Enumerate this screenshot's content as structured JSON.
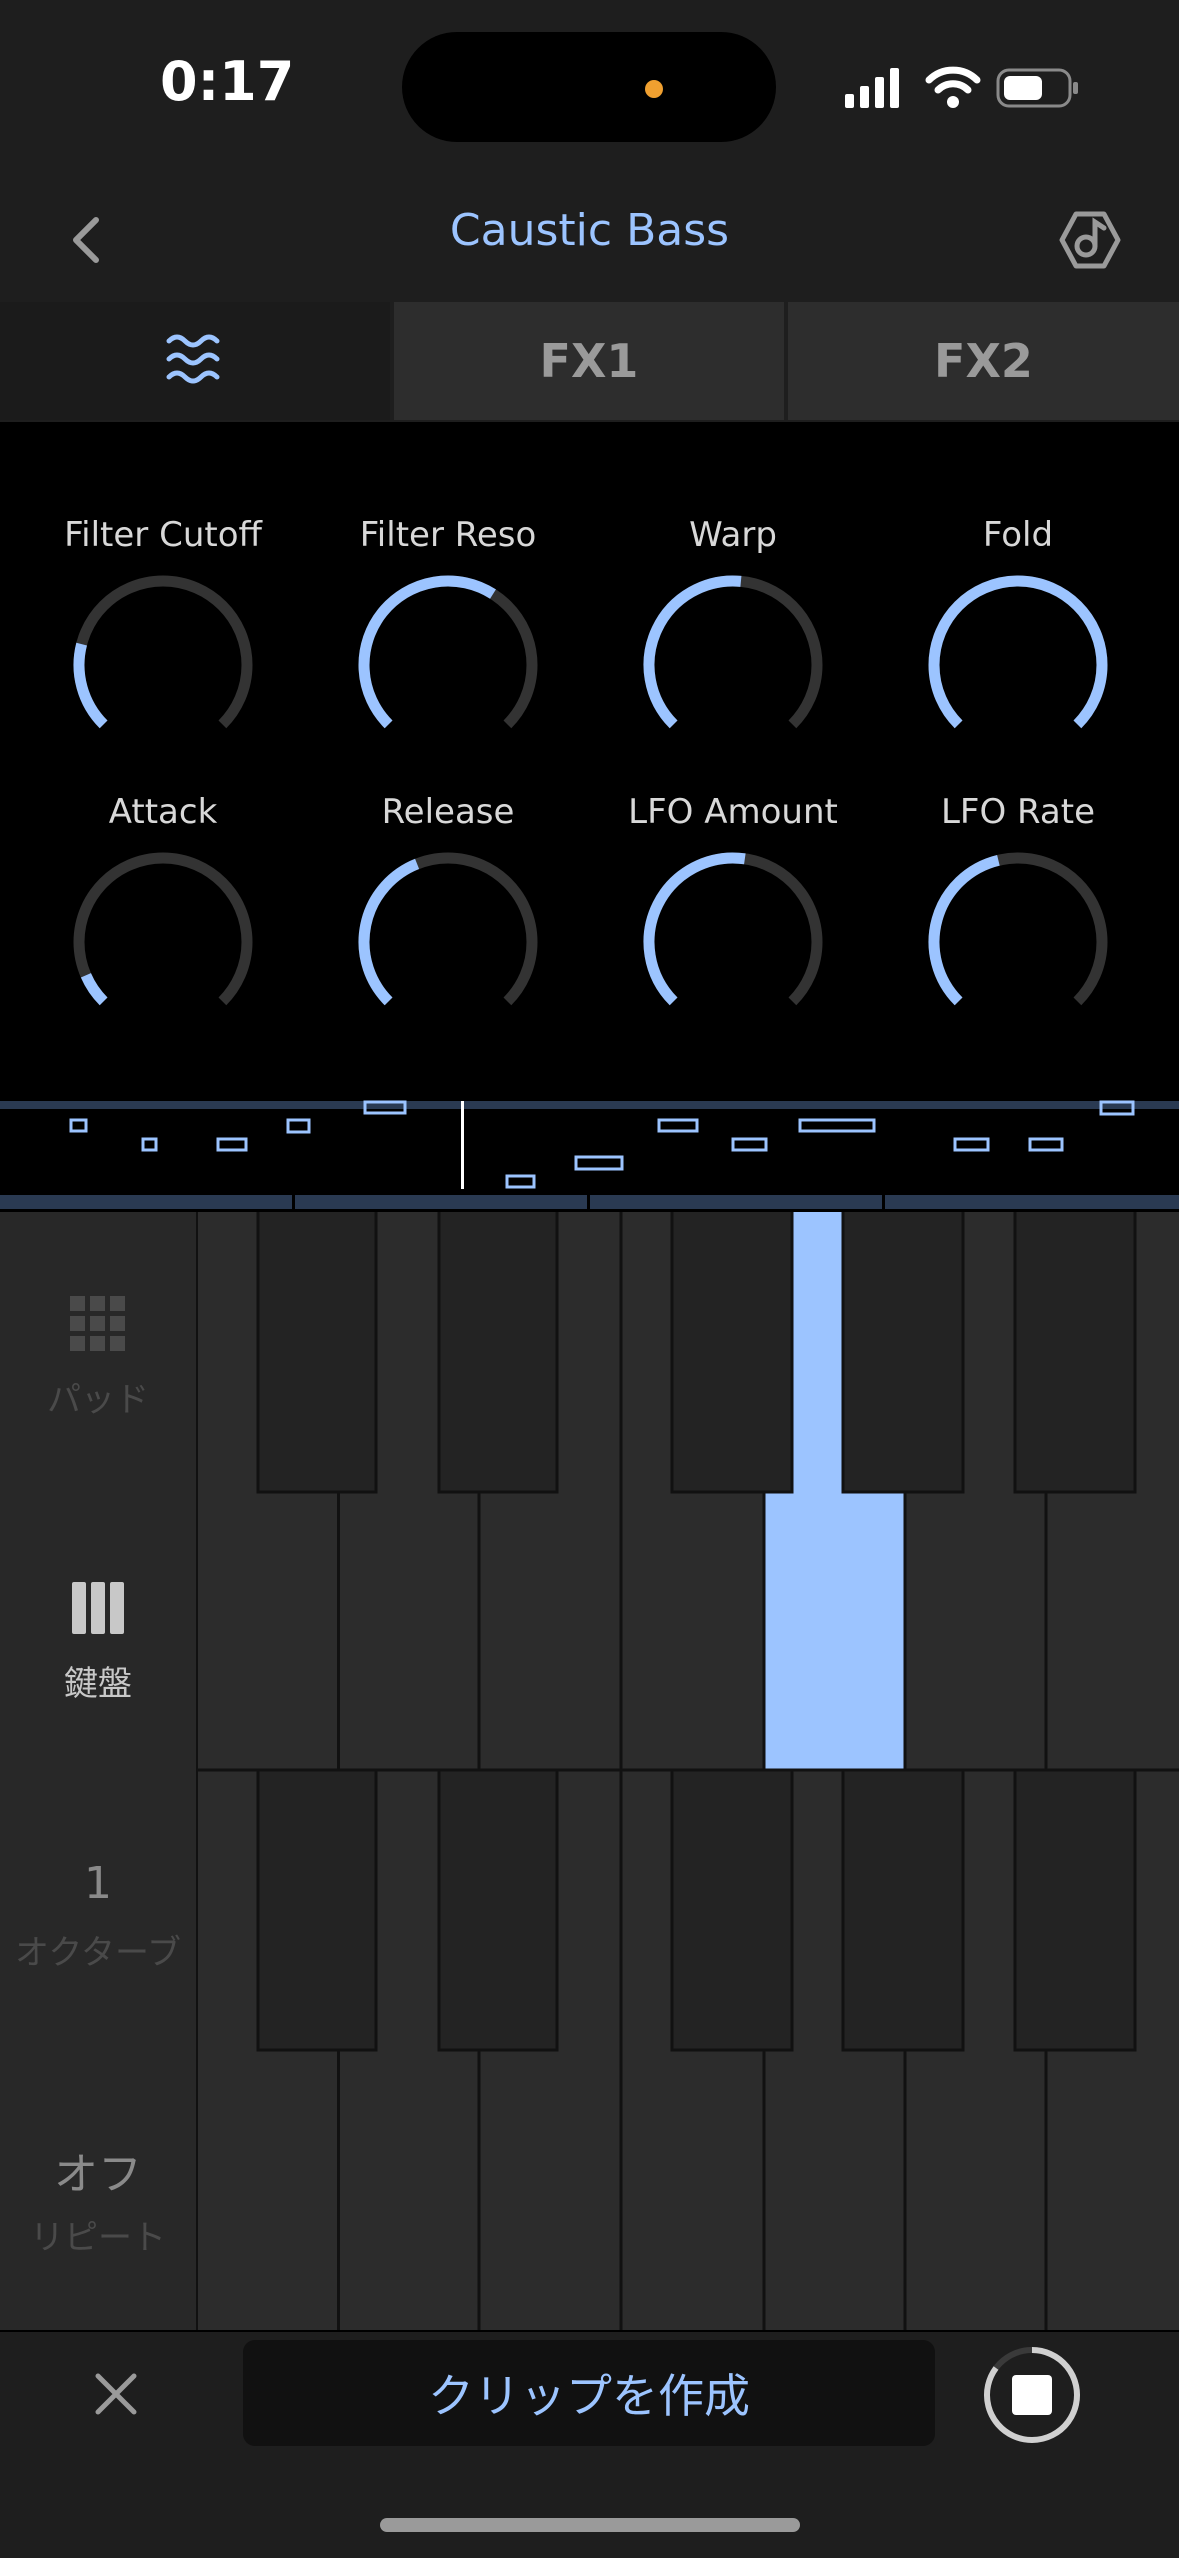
{
  "status_bar": {
    "time": "0:17"
  },
  "header": {
    "title": "Caustic Bass"
  },
  "tabs": [
    {
      "id": "waveform",
      "label": ""
    },
    {
      "id": "fx1",
      "label": "FX1"
    },
    {
      "id": "fx2",
      "label": "FX2"
    }
  ],
  "knobs": [
    {
      "label": "Filter Cutoff",
      "value": 0.22
    },
    {
      "label": "Filter Reso",
      "value": 0.62
    },
    {
      "label": "Warp",
      "value": 0.52
    },
    {
      "label": "Fold",
      "value": 1.0
    },
    {
      "label": "Attack",
      "value": 0.08
    },
    {
      "label": "Release",
      "value": 0.42
    },
    {
      "label": "LFO Amount",
      "value": 0.53
    },
    {
      "label": "LFO Rate",
      "value": 0.45
    }
  ],
  "left_panel": {
    "pads_label": "パッド",
    "keys_label": "鍵盤",
    "octave_value": "1",
    "octave_label": "オクターブ",
    "repeat_value": "オフ",
    "repeat_label": "リピート"
  },
  "bottom_bar": {
    "create_clip_label": "クリップを作成"
  },
  "colors": {
    "accent": "#9cc4ff",
    "background": "#000000",
    "panel": "#1e1e1e"
  }
}
